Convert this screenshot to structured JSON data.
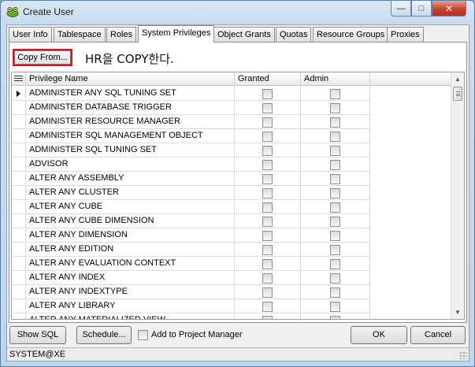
{
  "window": {
    "title": "Create User",
    "app_icon": "frog-icon",
    "controls": {
      "minimize": "—",
      "maximize": "□",
      "close": "✕"
    }
  },
  "tabs": [
    {
      "label": "User Info",
      "active": false
    },
    {
      "label": "Tablespace",
      "active": false
    },
    {
      "label": "Roles",
      "active": false
    },
    {
      "label": "System Privileges",
      "active": true
    },
    {
      "label": "Object Grants",
      "active": false
    },
    {
      "label": "Quotas",
      "active": false
    },
    {
      "label": "Resource Groups",
      "active": false
    },
    {
      "label": "Proxies",
      "active": false
    }
  ],
  "toolbar": {
    "copy_from_label": "Copy From...",
    "annotation": "HR을 COPY한다."
  },
  "grid": {
    "columns": {
      "icon": "grid-options-icon",
      "name": "Privilege Name",
      "granted": "Granted",
      "admin": "Admin"
    },
    "rows": [
      {
        "name": "ADMINISTER ANY SQL TUNING SET",
        "granted": false,
        "admin": false,
        "current": true
      },
      {
        "name": "ADMINISTER DATABASE TRIGGER",
        "granted": false,
        "admin": false
      },
      {
        "name": "ADMINISTER RESOURCE MANAGER",
        "granted": false,
        "admin": false
      },
      {
        "name": "ADMINISTER SQL MANAGEMENT OBJECT",
        "granted": false,
        "admin": false
      },
      {
        "name": "ADMINISTER SQL TUNING SET",
        "granted": false,
        "admin": false
      },
      {
        "name": "ADVISOR",
        "granted": false,
        "admin": false
      },
      {
        "name": "ALTER ANY ASSEMBLY",
        "granted": false,
        "admin": false
      },
      {
        "name": "ALTER ANY CLUSTER",
        "granted": false,
        "admin": false
      },
      {
        "name": "ALTER ANY CUBE",
        "granted": false,
        "admin": false
      },
      {
        "name": "ALTER ANY CUBE DIMENSION",
        "granted": false,
        "admin": false
      },
      {
        "name": "ALTER ANY DIMENSION",
        "granted": false,
        "admin": false
      },
      {
        "name": "ALTER ANY EDITION",
        "granted": false,
        "admin": false
      },
      {
        "name": "ALTER ANY EVALUATION CONTEXT",
        "granted": false,
        "admin": false
      },
      {
        "name": "ALTER ANY INDEX",
        "granted": false,
        "admin": false
      },
      {
        "name": "ALTER ANY INDEXTYPE",
        "granted": false,
        "admin": false
      },
      {
        "name": "ALTER ANY LIBRARY",
        "granted": false,
        "admin": false
      },
      {
        "name": "ALTER ANY MATERIALIZED VIEW",
        "granted": false,
        "admin": false
      }
    ],
    "scrollbar": {
      "up": "▲",
      "down": "▼"
    }
  },
  "footer": {
    "show_sql": "Show SQL",
    "schedule": "Schedule...",
    "add_to_project_label": "Add to Project Manager",
    "add_to_project_checked": false,
    "ok": "OK",
    "cancel": "Cancel"
  },
  "status": {
    "connection": "SYSTEM@XE"
  }
}
